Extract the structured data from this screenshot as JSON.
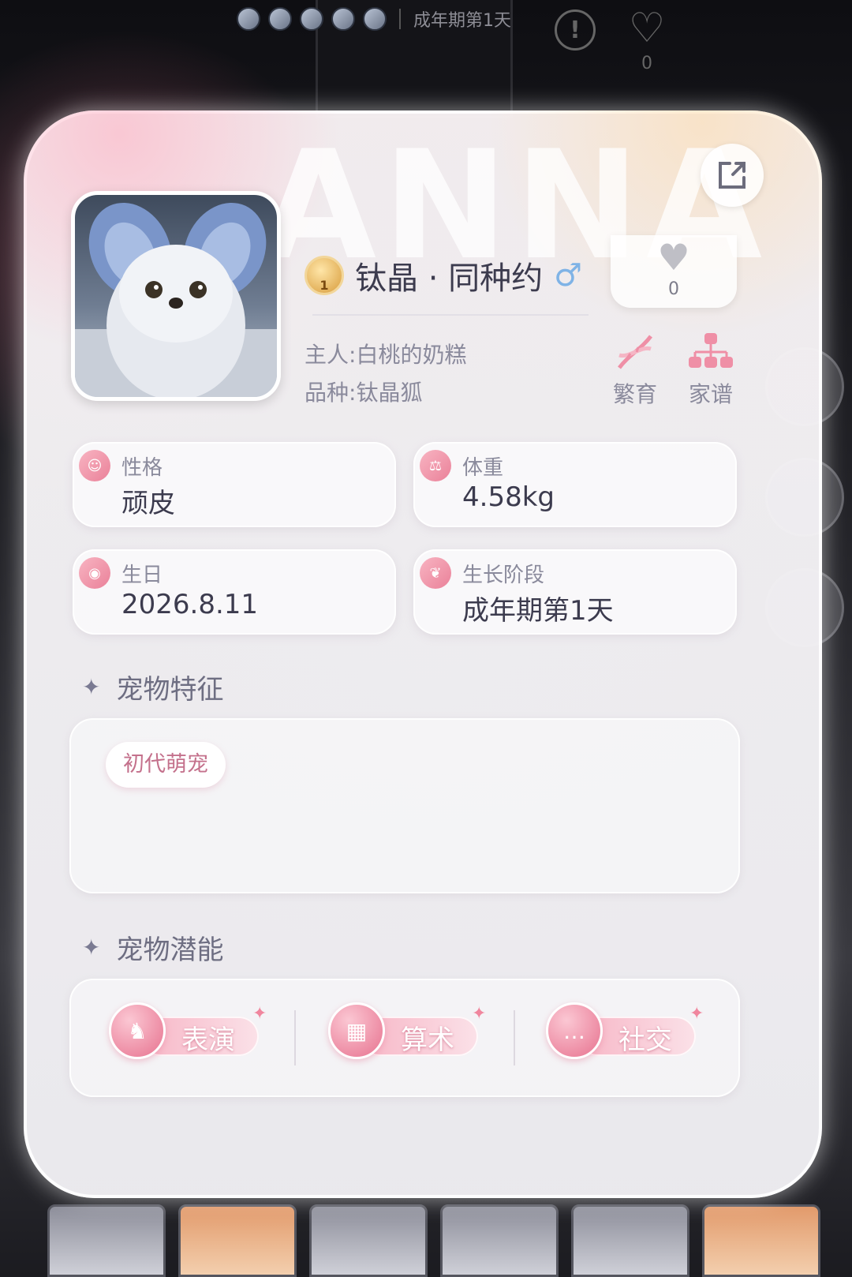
{
  "hud": {
    "stage": "成年期第1天",
    "alert": "!",
    "like_count": "0"
  },
  "card": {
    "watermark": "ANNA",
    "pet": {
      "badge_number": "1",
      "name": "钛晶 · 同种约",
      "gender_symbol": "♂",
      "likes": "0",
      "owner_label": "主人:",
      "owner_value": "白桃的奶糕",
      "breed_label": "品种:",
      "breed_value": "钛晶狐"
    },
    "actions": {
      "breed": "繁育",
      "family_tree": "家谱"
    },
    "info": {
      "personality_label": "性格",
      "personality_value": "顽皮",
      "weight_label": "体重",
      "weight_value": "4.58kg",
      "birthday_label": "生日",
      "birthday_value": "2026.8.11",
      "stage_label": "生长阶段",
      "stage_value": "成年期第1天"
    },
    "traits": {
      "title": "宠物特征",
      "tags": [
        "初代萌宠"
      ]
    },
    "potential": {
      "title": "宠物潜能",
      "items": [
        "表演",
        "算术",
        "社交"
      ]
    }
  },
  "icons": {
    "share": "share-icon",
    "heart": "heart-icon",
    "dna": "dna-icon",
    "family": "family-tree-icon",
    "alert": "alert-icon"
  },
  "colors": {
    "accent_pink": "#ea8199",
    "text_dark": "#3c3b4e",
    "text_muted": "#8a8a9c",
    "gender_blue": "#7fb3e6"
  }
}
